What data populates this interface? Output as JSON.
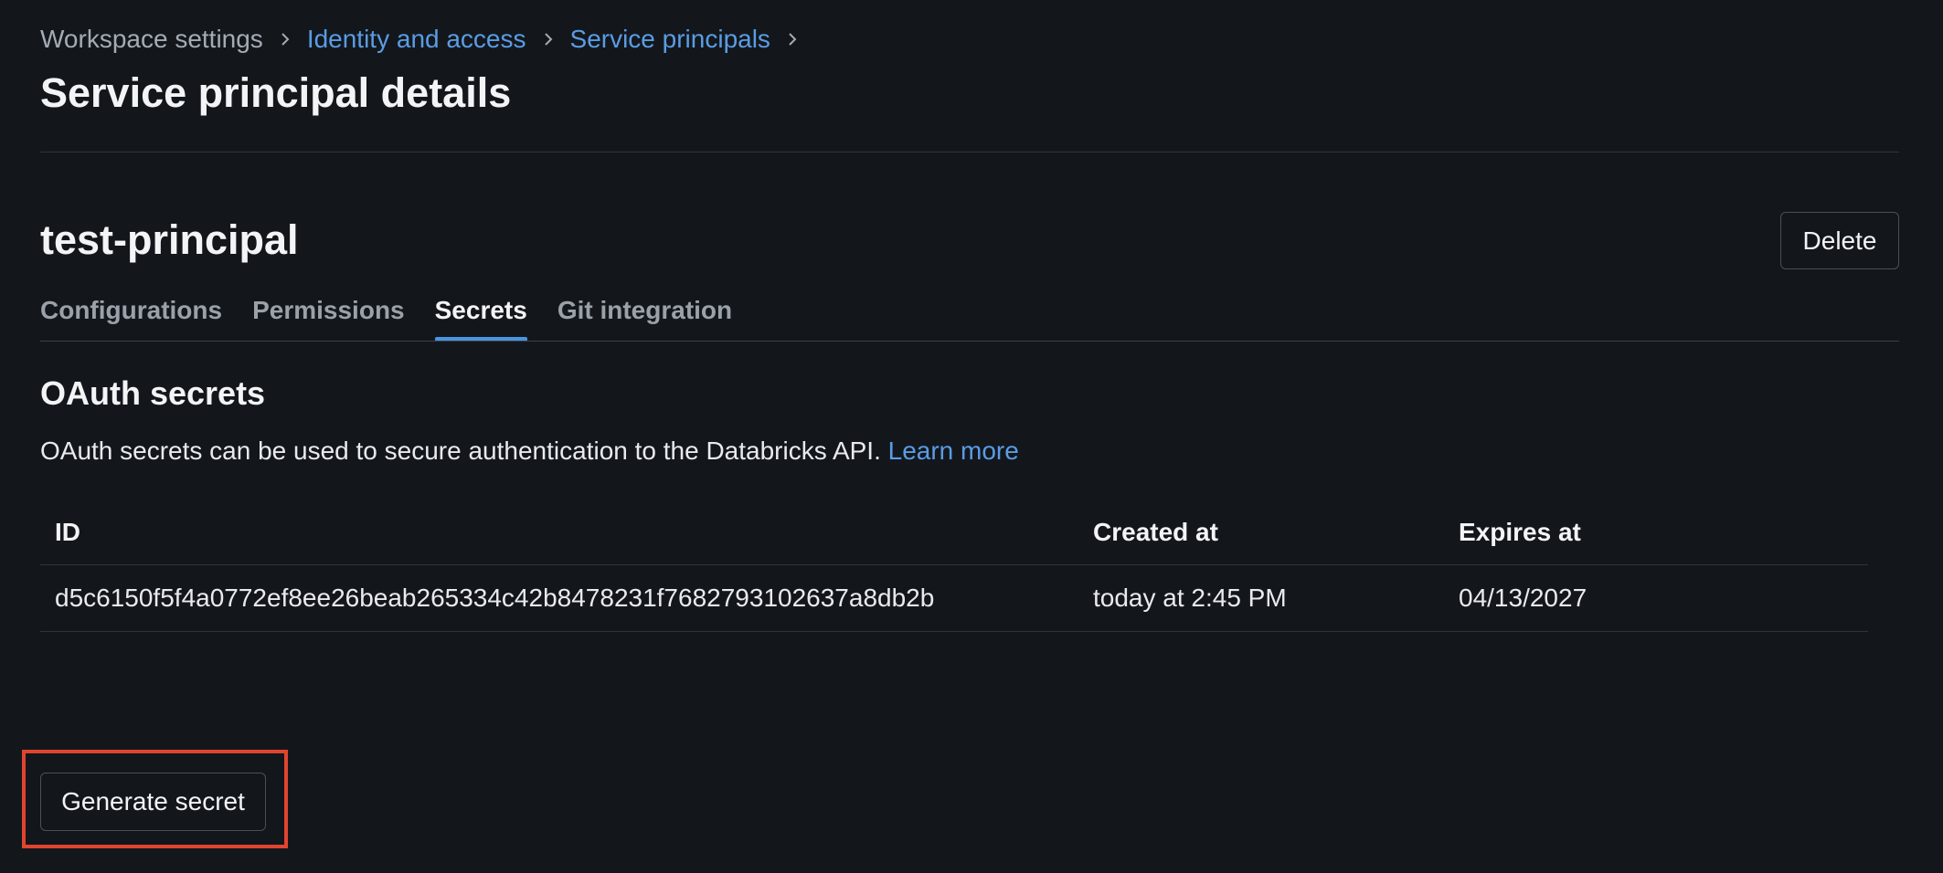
{
  "breadcrumb": {
    "items": [
      {
        "label": "Workspace settings",
        "link": false
      },
      {
        "label": "Identity and access",
        "link": true
      },
      {
        "label": "Service principals",
        "link": true
      }
    ],
    "separator_icon": "chevron-right-icon"
  },
  "page": {
    "title": "Service principal details"
  },
  "principal": {
    "name": "test-principal",
    "delete_label": "Delete"
  },
  "tabs": [
    {
      "label": "Configurations",
      "active": false
    },
    {
      "label": "Permissions",
      "active": false
    },
    {
      "label": "Secrets",
      "active": true
    },
    {
      "label": "Git integration",
      "active": false
    }
  ],
  "secrets": {
    "title": "OAuth secrets",
    "description": "OAuth secrets can be used to secure authentication to the Databricks API.",
    "learn_more": "Learn more",
    "table": {
      "columns": [
        "ID",
        "Created at",
        "Expires at"
      ],
      "rows": [
        {
          "id": "d5c6150f5f4a0772ef8ee26beab265334c42b8478231f7682793102637a8db2b",
          "created_at": "today at 2:45 PM",
          "expires_at": "04/13/2027"
        }
      ]
    },
    "generate_label": "Generate secret"
  },
  "colors": {
    "background": "#13171c",
    "link": "#5a9ce4",
    "active_tab_underline": "#4b94df",
    "highlight_box": "#e0452f"
  }
}
